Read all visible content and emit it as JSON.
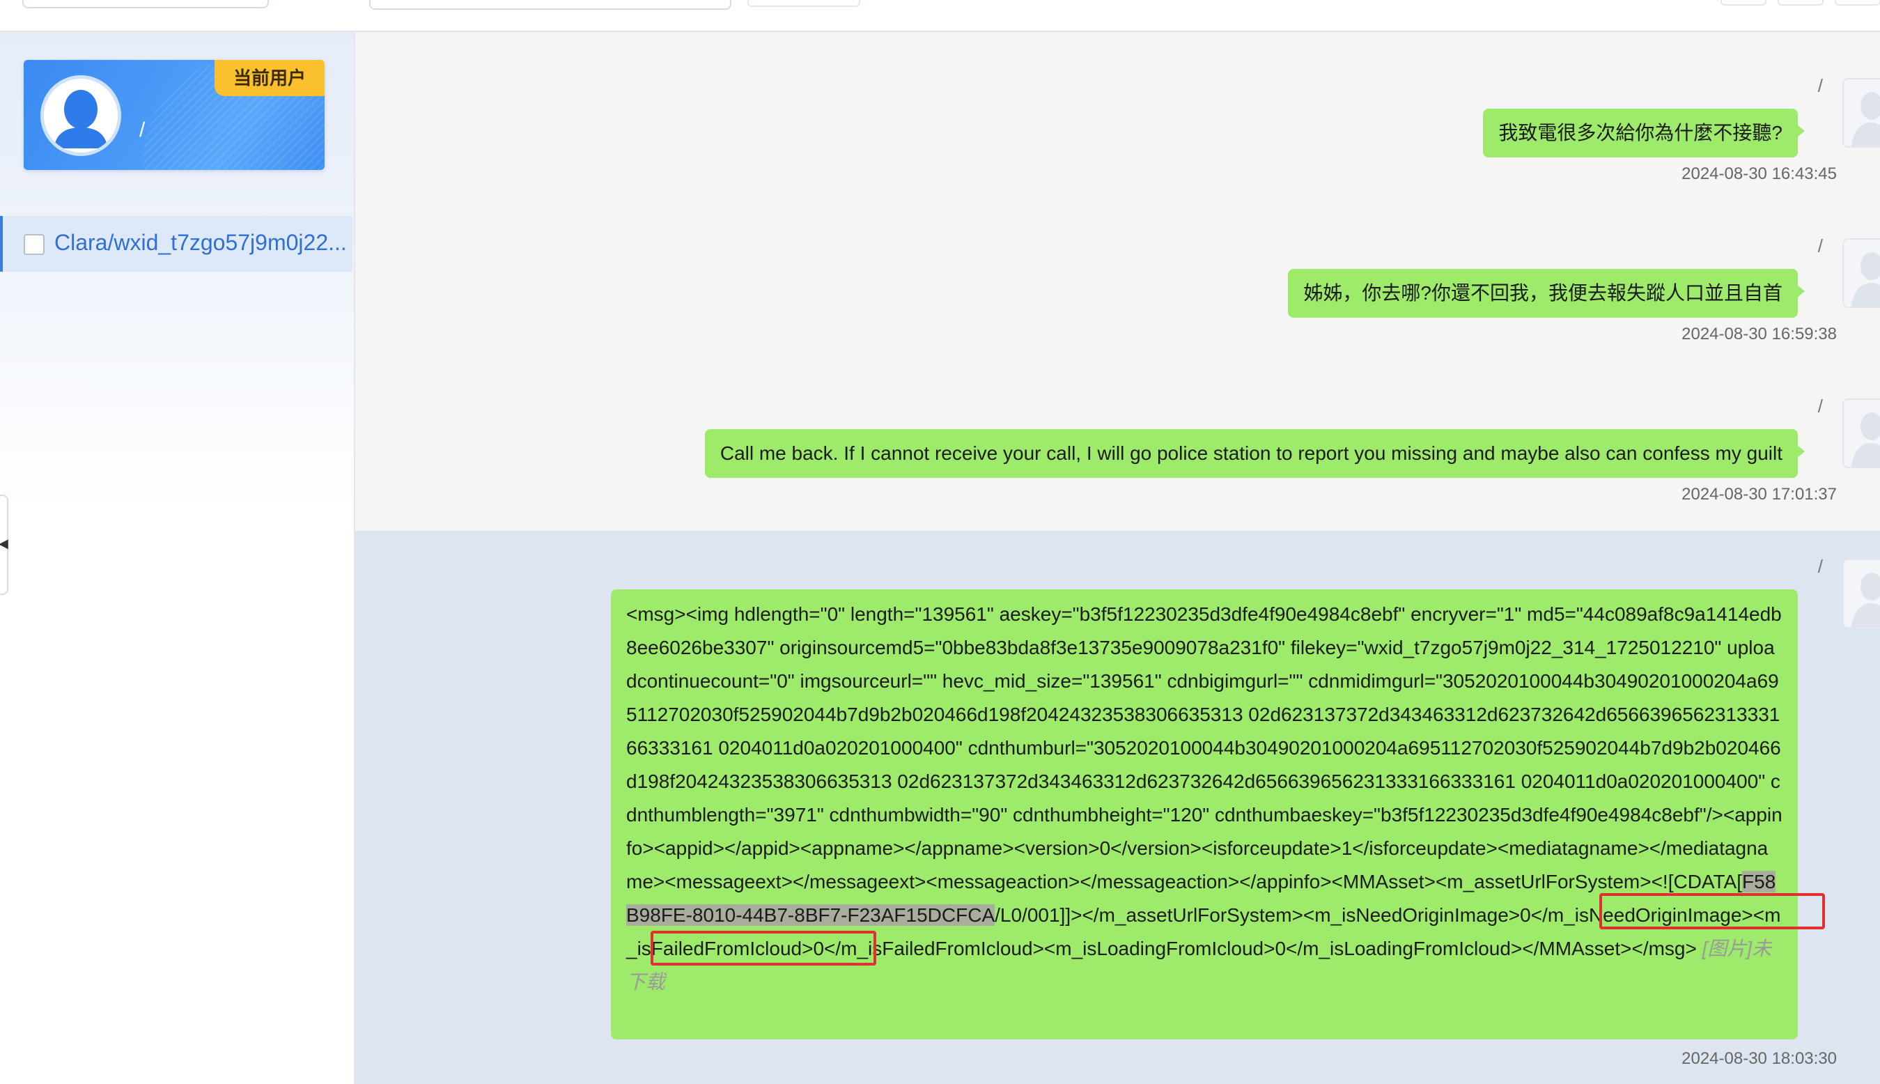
{
  "sidebar": {
    "current_user_badge": "当前用户",
    "current_user_name": "/",
    "contacts": [
      {
        "label": "Clara/wxid_t7zgo57j9m0j22..."
      }
    ]
  },
  "messages": [
    {
      "sender": "/",
      "text": "我致電很多次給你為什麼不接聽?",
      "time": "2024-08-30 16:43:45"
    },
    {
      "sender": "/",
      "text": "姊姊，你去哪?你還不回我，我便去報失蹤人口並且自首",
      "time": "2024-08-30 16:59:38"
    },
    {
      "sender": "/",
      "text": "Call me back. If I cannot receive your call, I will go police station to report you missing and maybe also can confess my guilt",
      "time": "2024-08-30 17:01:37"
    },
    {
      "sender": "/",
      "xml_before": "<msg><img hdlength=\"0\" length=\"139561\" aeskey=\"b3f5f12230235d3dfe4f90e4984c8ebf\" encryver=\"1\" md5=\"44c089af8c9a1414edb8ee6026be3307\" originsourcemd5=\"0bbe83bda8f3e13735e9009078a231f0\" filekey=\"wxid_t7zgo57j9m0j22_314_1725012210\" uploadcontinuecount=\"0\" imgsourceurl=\"\" hevc_mid_size=\"139561\" cdnbigimgurl=\"\" cdnmidimgurl=\"3052020100044b30490201000204a695112702030f525902044b7d9b2b020466d198f20424323538306635313 02d623137372d343463312d623732642d656639656231333166333161 0204011d0a020201000400\" cdnthumburl=\"3052020100044b30490201000204a695112702030f525902044b7d9b2b020466d198f20424323538306635313 02d623137372d343463312d623732642d656639656231333166333161 0204011d0a020201000400\" cdnthumblength=\"3971\" cdnthumbwidth=\"90\" cdnthumbheight=\"120\" cdnthumbaeskey=\"b3f5f12230235d3dfe4f90e4984c8ebf\"/><appinfo><appid></appid><appname></appname><version>0</version><isforceupdate>1</isforceupdate><mediatagname></mediatagname><messageext></messageext><messageaction></messageaction></appinfo><MMAsset><m_assetUrlForSystem><![CDATA[",
      "xml_highlight": "F58B98FE-8010-44B7-8BF7-F23AF15DCFCA",
      "xml_after": "/L0/001]]></m_assetUrlForSystem><m_isNeedOriginImage>0</m_isNeedOriginImage><m_isFailedFromIcloud>0</m_isFailedFromIcloud><m_isLoadingFromIcloud>0</m_isLoadingFromIcloud></MMAsset></msg>",
      "image_status": "[图片]未下载",
      "time": "2024-08-30 18:03:30"
    }
  ],
  "colors": {
    "bubble_green": "#9eea6a",
    "badge_yellow": "#fbc02d",
    "card_blue": "#3a8af2",
    "highlight_row": "#dde5f1",
    "annotation_red": "#e03030"
  }
}
